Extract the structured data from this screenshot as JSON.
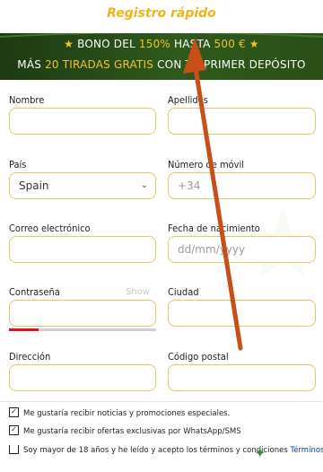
{
  "form_title": "Registro rápido",
  "banner": {
    "line1_prefix": "BONO DEL ",
    "line1_percent": "150%",
    "line1_mid": " HASTA ",
    "line1_amount": "500 €",
    "line2_prefix": "MÁS ",
    "line2_highlight": "20 TIRADAS GRATIS",
    "line2_suffix": " CON TU PRIMER DEPÓSITO",
    "star_icon": "★"
  },
  "fields": {
    "nombre": {
      "label": "Nombre",
      "value": ""
    },
    "apellidos": {
      "label": "Apellidos",
      "value": ""
    },
    "pais": {
      "label": "País",
      "value": "Spain",
      "chevron": "⌄"
    },
    "movil": {
      "label": "Número de móvil",
      "prefix": "+34"
    },
    "correo": {
      "label": "Correo electrónico",
      "value": ""
    },
    "nacimiento": {
      "label": "Fecha de nacimiento",
      "placeholder": "dd/mm/yyyy"
    },
    "contrasena": {
      "label": "Contraseña",
      "show_label": "Show",
      "strength": 0.2
    },
    "ciudad": {
      "label": "Ciudad",
      "value": ""
    },
    "direccion": {
      "label": "Dirección",
      "value": ""
    },
    "postal": {
      "label": "Código postal",
      "value": ""
    }
  },
  "checkboxes": [
    {
      "label": "Me gustaría recibir noticias y promociones especiales.",
      "checked": true,
      "mark": "✓"
    },
    {
      "label": "Me gustaría recibir ofertas exclusivas por WhatsApp/SMS",
      "checked": true,
      "mark": "✓"
    },
    {
      "label": "Soy mayor de 18 años y he leído y acepto los términos y condiciones ",
      "link": "Términos y",
      "checked": false,
      "mark": ""
    }
  ],
  "colors": {
    "accent_gold": "#f0b418",
    "banner_green": "#2f5a1c",
    "field_border": "#e3c76b",
    "arrow": "#c84f17",
    "strength_red": "#d21818"
  }
}
